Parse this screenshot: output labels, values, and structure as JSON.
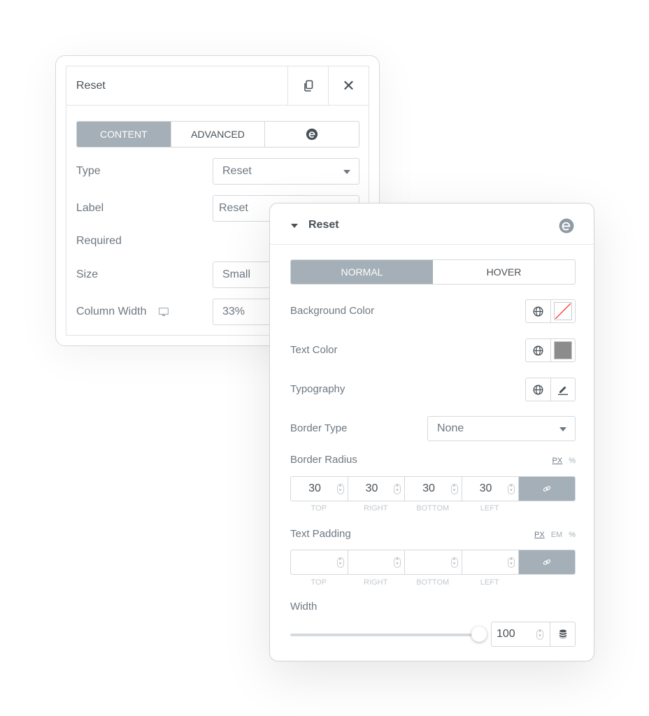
{
  "widget_panel": {
    "title": "Reset",
    "tabs": [
      {
        "label": "CONTENT",
        "active": true
      },
      {
        "label": "ADVANCED",
        "active": false
      },
      {
        "label": "",
        "icon": "elementor-logo-icon",
        "active": false
      }
    ],
    "fields": [
      {
        "label": "Type",
        "value": "Reset",
        "control": "select"
      },
      {
        "label": "Label",
        "value": "Reset",
        "control": "text"
      },
      {
        "label": "Required",
        "value": "",
        "control": "switch"
      },
      {
        "label": "Size",
        "value": "Small",
        "control": "select"
      },
      {
        "label": "Column Width",
        "value": "33%",
        "control": "select",
        "responsive_icon": "desktop-icon"
      }
    ]
  },
  "style_panel": {
    "section_title": "Reset",
    "tabs": [
      {
        "label": "NORMAL",
        "active": true
      },
      {
        "label": "HOVER",
        "active": false
      }
    ],
    "background_color": {
      "label": "Background Color",
      "value": "none",
      "swatch_color": "#ffffff"
    },
    "text_color": {
      "label": "Text Color",
      "swatch_color": "#8c8c8c"
    },
    "typography": {
      "label": "Typography"
    },
    "border_type": {
      "label": "Border Type",
      "value": "None"
    },
    "border_radius": {
      "label": "Border Radius",
      "units": [
        "PX",
        "%"
      ],
      "selected_unit": "PX",
      "values": [
        "30",
        "30",
        "30",
        "30"
      ],
      "sides": [
        "TOP",
        "RIGHT",
        "BOTTOM",
        "LEFT"
      ]
    },
    "text_padding": {
      "label": "Text Padding",
      "units": [
        "PX",
        "EM",
        "%"
      ],
      "selected_unit": "PX",
      "values": [
        "",
        "",
        "",
        ""
      ],
      "sides": [
        "TOP",
        "RIGHT",
        "BOTTOM",
        "LEFT"
      ]
    },
    "width": {
      "label": "Width",
      "value": "100",
      "slider_percent": 100
    }
  },
  "colors": {
    "accent_gray": "#a4afb7",
    "border": "#d5d8dc",
    "text": "#6d7882",
    "heading": "#495157",
    "none_slash": "#ff3b3b"
  }
}
